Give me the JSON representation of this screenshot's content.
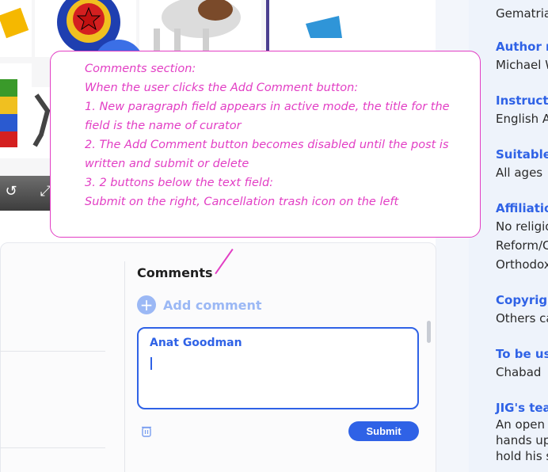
{
  "annotation": {
    "lines": [
      "Comments section:",
      "When the user clicks the Add Comment button:",
      "1. New paragraph field appears in active mode, the title for the",
      "field is the name of curator",
      "2. The Add Comment button becomes disabled until the post is",
      "written and submit or delete",
      "3. 2 buttons below the text field:",
      "Submit on the right, Cancellation trash icon on the left"
    ]
  },
  "comments": {
    "title": "Comments",
    "add_comment_label": "Add comment",
    "curator_name": "Anat Goodman",
    "submit_label": "Submit"
  },
  "info_panel": {
    "gematria_value": "Gematria",
    "author_label": "Author n",
    "author_value": "Michael W",
    "instruction_label": "Instructio",
    "instruction_value": "English A",
    "suitable_label": "Suitable f",
    "suitable_value": "All ages",
    "affiliation_label": "Affiliation",
    "affiliation_values": [
      "No religio",
      "Reform/C",
      "Orthodox"
    ],
    "copyright_label": "Copyrigh",
    "copyright_value": "Others ca",
    "to_be_used_label": "To be use",
    "to_be_used_value": "Chabad",
    "jig_label": "JIG's teac",
    "jig_values": [
      "An open",
      "hands up",
      "hold his s"
    ]
  },
  "colors": {
    "accent": "#2f62e6",
    "annotation": "#e23ec4",
    "disabled_accent": "#9bb8f5"
  }
}
